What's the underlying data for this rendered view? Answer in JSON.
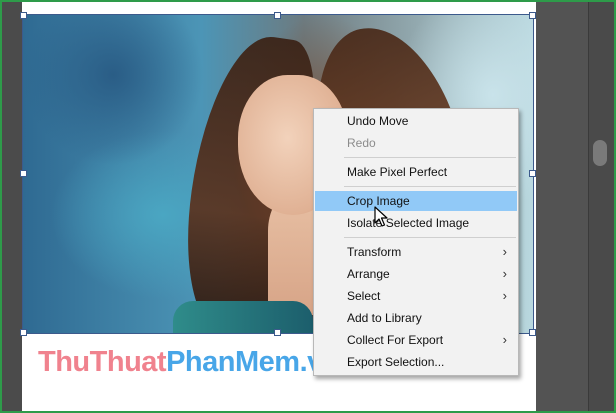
{
  "context_menu": {
    "undo_move": "Undo Move",
    "redo": "Redo",
    "make_pixel_perfect": "Make Pixel Perfect",
    "crop_image": "Crop Image",
    "isolate_selected_image": "Isolate Selected Image",
    "transform": "Transform",
    "arrange": "Arrange",
    "select": "Select",
    "add_to_library": "Add to Library",
    "collect_for_export": "Collect For Export",
    "export_selection": "Export Selection...",
    "submenu_arrow": "›",
    "highlight_color": "#91c9f7"
  },
  "watermark": {
    "part1": "Thu",
    "part2": "Thuat",
    "part3": "Phan",
    "part4": "Mem.vn"
  },
  "colors": {
    "frame_border": "#2e9b4a",
    "watermark_pink": "#f0828e",
    "watermark_blue": "#48a6e8"
  }
}
